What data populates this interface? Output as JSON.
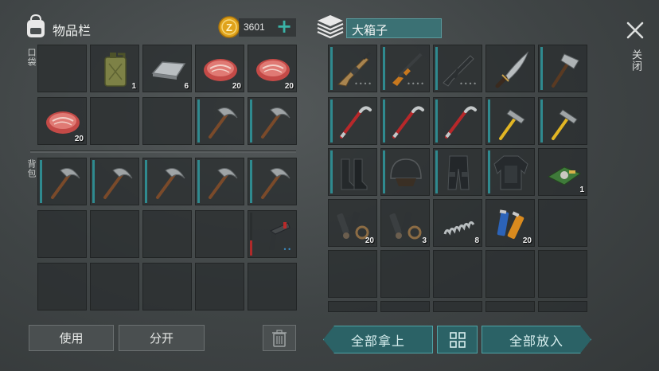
{
  "inventory": {
    "title": "物品栏",
    "currency": "3601",
    "pocket_label": "口袋",
    "backpack_label": "背包",
    "use_label": "使用",
    "split_label": "分开",
    "slots": {
      "jerrycan": "1",
      "iron_bar": "6",
      "meat1": "20",
      "meat2": "20",
      "meat3": "20"
    }
  },
  "container": {
    "title": "大箱子",
    "close_label": "关闭",
    "take_all_label": "全部拿上",
    "put_all_label": "全部放入",
    "slots": {
      "chip": "1",
      "parts1": "20",
      "parts2": "3",
      "springs": "8",
      "batteries": "20"
    }
  },
  "colors": {
    "accent_teal": "#2b6266",
    "durability": "#2f8a8f",
    "coin": "#e0a31b"
  }
}
